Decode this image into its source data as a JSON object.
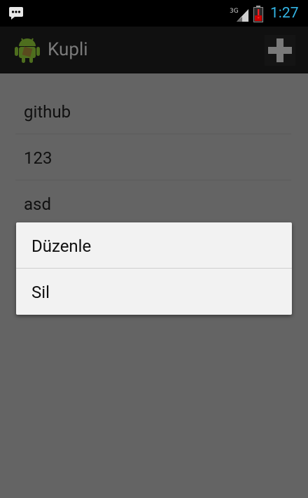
{
  "status_bar": {
    "time": "1:27",
    "network_label": "3G",
    "icons": [
      "message-icon",
      "signal-3g-icon",
      "battery-low-icon"
    ],
    "clock_color": "#33b5e5"
  },
  "action_bar": {
    "title": "Kupli",
    "add_icon": "plus-icon",
    "app_icon": "android-robot-icon"
  },
  "list": {
    "items": [
      {
        "label": "github"
      },
      {
        "label": "123"
      },
      {
        "label": "asd"
      }
    ]
  },
  "context_menu": {
    "options": [
      {
        "label": "Düzenle"
      },
      {
        "label": "Sil"
      }
    ]
  }
}
